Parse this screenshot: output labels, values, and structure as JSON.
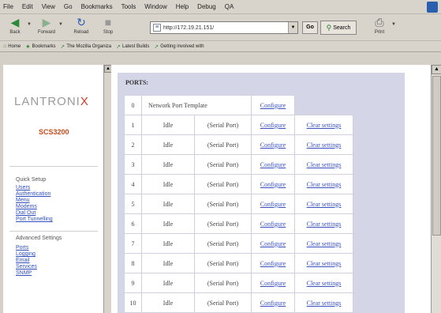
{
  "browser": {
    "menu": [
      "File",
      "Edit",
      "View",
      "Go",
      "Bookmarks",
      "Tools",
      "Window",
      "Help",
      "Debug",
      "QA"
    ],
    "nav": {
      "back": "Back",
      "forward": "Forward",
      "reload": "Reload",
      "stop": "Stop",
      "print": "Print"
    },
    "url": "http://172.19.21.151/",
    "go": "Go",
    "search": "Search",
    "bookmarks": [
      "Home",
      "Bookmarks",
      "The Mozilla Organiza",
      "Latest Builds",
      "Getting involved with"
    ]
  },
  "left": {
    "logo_pre": "LANTRONI",
    "logo_x": "X",
    "model": "SCS3200",
    "quick_setup_title": "Quick Setup",
    "quick_links": [
      "Users",
      "Authentication",
      "Menu",
      "Modems",
      "Dial Out",
      "Port Tunnelling"
    ],
    "advanced_title": "Advanced Settings",
    "advanced_links": [
      "Ports",
      "Logging",
      "Email",
      "Services",
      "SNMP"
    ]
  },
  "main": {
    "title": "PORTS:",
    "template_row": {
      "num": "0",
      "label": "Network Port Template",
      "configure": "Configure"
    },
    "rows": [
      {
        "num": "1",
        "status": "Idle",
        "type": "(Serial Port)",
        "configure": "Configure",
        "clear": "Clear settings"
      },
      {
        "num": "2",
        "status": "Idle",
        "type": "(Serial Port)",
        "configure": "Configure",
        "clear": "Clear settings"
      },
      {
        "num": "3",
        "status": "Idle",
        "type": "(Serial Port)",
        "configure": "Configure",
        "clear": "Clear settings"
      },
      {
        "num": "4",
        "status": "Idle",
        "type": "(Serial Port)",
        "configure": "Configure",
        "clear": "Clear settings"
      },
      {
        "num": "5",
        "status": "Idle",
        "type": "(Serial Port)",
        "configure": "Configure",
        "clear": "Clear settings"
      },
      {
        "num": "6",
        "status": "Idle",
        "type": "(Serial Port)",
        "configure": "Configure",
        "clear": "Clear settings"
      },
      {
        "num": "7",
        "status": "Idle",
        "type": "(Serial Port)",
        "configure": "Configure",
        "clear": "Clear settings"
      },
      {
        "num": "8",
        "status": "Idle",
        "type": "(Serial Port)",
        "configure": "Configure",
        "clear": "Clear settings"
      },
      {
        "num": "9",
        "status": "Idle",
        "type": "(Serial Port)",
        "configure": "Configure",
        "clear": "Clear settings"
      },
      {
        "num": "10",
        "status": "Idle",
        "type": "(Serial Port)",
        "configure": "Configure",
        "clear": "Clear settings"
      }
    ]
  },
  "colors": {
    "link": "#3a50c0",
    "panel": "#d5d5e8",
    "logo_x": "#cc3a2a",
    "model": "#c84a1a"
  }
}
